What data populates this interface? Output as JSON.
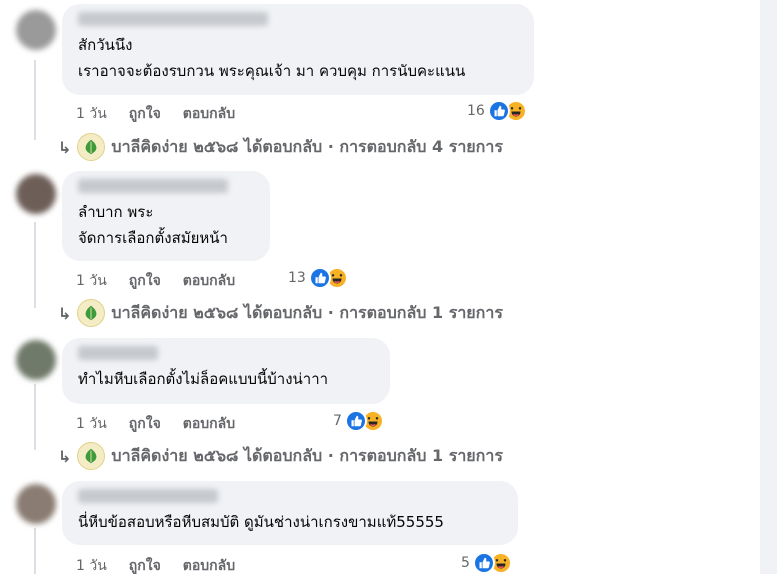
{
  "comments": [
    {
      "lines": [
        "สักวันนึง",
        "เราอาจจะต้องรบกวน พระคุณเจ้า มา ควบคุม การนับคะแนน"
      ],
      "time": "1 วัน",
      "like_label": "ถูกใจ",
      "reply_label": "ตอบกลับ",
      "reaction_count": "16",
      "reply_summary": "บาลีคิดง่าย ๒๕๖๘ ได้ตอบกลับ · การตอบกลับ 4 รายการ"
    },
    {
      "lines": [
        "ลำบาก พระ",
        "จัดการเลือกตั้งสมัยหน้า"
      ],
      "time": "1 วัน",
      "like_label": "ถูกใจ",
      "reply_label": "ตอบกลับ",
      "reaction_count": "13",
      "reply_summary": "บาลีคิดง่าย ๒๕๖๘ ได้ตอบกลับ · การตอบกลับ 1 รายการ"
    },
    {
      "lines": [
        "ทำไมหีบเลือกตั้งไม่ล็อคแบบนี้บ้างน่าาา"
      ],
      "time": "1 วัน",
      "like_label": "ถูกใจ",
      "reply_label": "ตอบกลับ",
      "reaction_count": "7",
      "reply_summary": "บาลีคิดง่าย ๒๕๖๘ ได้ตอบกลับ · การตอบกลับ 1 รายการ"
    },
    {
      "lines": [
        "นี่หีบข้อสอบหรือหีบสมบัติ ดูมันช่างน่าเกรงขามแท้55555"
      ],
      "time": "1 วัน",
      "like_label": "ถูกใจ",
      "reply_label": "ตอบกลับ",
      "reaction_count": "5"
    }
  ],
  "icons": {
    "reply_arrow": "reply-arrow-icon",
    "like": "like-icon",
    "haha": "haha-icon",
    "page_logo": "bodhi-leaf-logo"
  },
  "colors": {
    "bubble": "#f0f2f5",
    "secondary_text": "#65676b",
    "like_blue": "#1b74e4",
    "haha_yellow": "#f7b125"
  }
}
